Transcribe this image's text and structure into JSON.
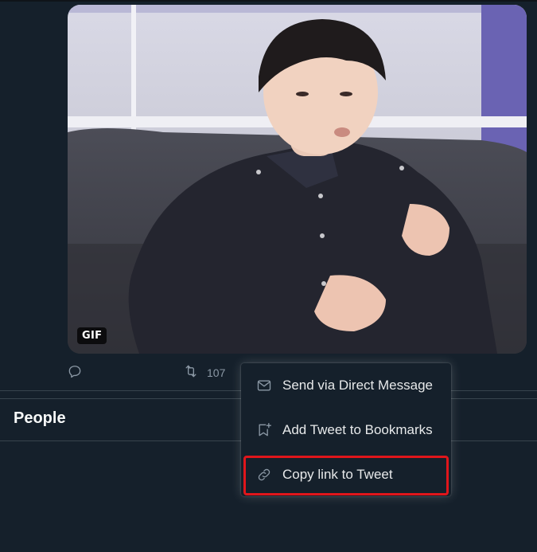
{
  "tweet": {
    "media": {
      "badge": "GIF",
      "kind": "animated-gif"
    },
    "actions": {
      "reply": {
        "icon": "reply-icon"
      },
      "retweet": {
        "icon": "retweet-icon",
        "count": "107"
      }
    }
  },
  "sections": {
    "people_title": "People"
  },
  "share_menu": {
    "items": [
      {
        "label": "Send via Direct Message",
        "icon": "envelope-icon"
      },
      {
        "label": "Add Tweet to Bookmarks",
        "icon": "bookmark-add-icon"
      },
      {
        "label": "Copy link to Tweet",
        "icon": "link-icon",
        "highlighted": true
      }
    ],
    "highlight_color": "#e0161b"
  },
  "colors": {
    "background": "#15202b",
    "muted_text": "#8b98a5",
    "divider": "#38444d"
  }
}
